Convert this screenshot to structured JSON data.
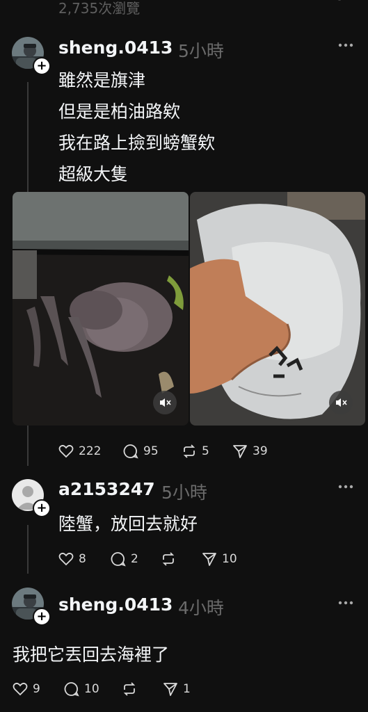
{
  "views": "2,735次瀏覽",
  "post1": {
    "username": "sheng.0413",
    "time": "5小時",
    "lines": [
      "雖然是旗津",
      "但是是柏油路欸",
      "我在路上撿到螃蟹欸",
      "超級大隻"
    ],
    "actions": {
      "likes": "222",
      "comments": "95",
      "reposts": "5",
      "shares": "39"
    }
  },
  "post2": {
    "username": "a2153247",
    "time": "5小時",
    "text": "陸蟹，放回去就好",
    "actions": {
      "likes": "8",
      "comments": "2",
      "reposts": "",
      "shares": "10"
    }
  },
  "post3": {
    "username": "sheng.0413",
    "time": "4小時",
    "text": "我把它丟回去海裡了",
    "actions": {
      "likes": "9",
      "comments": "10",
      "reposts": "",
      "shares": "1"
    }
  },
  "colors": {
    "background": "#101010",
    "text": "#f3f5f7",
    "muted": "#6b6b6b"
  }
}
